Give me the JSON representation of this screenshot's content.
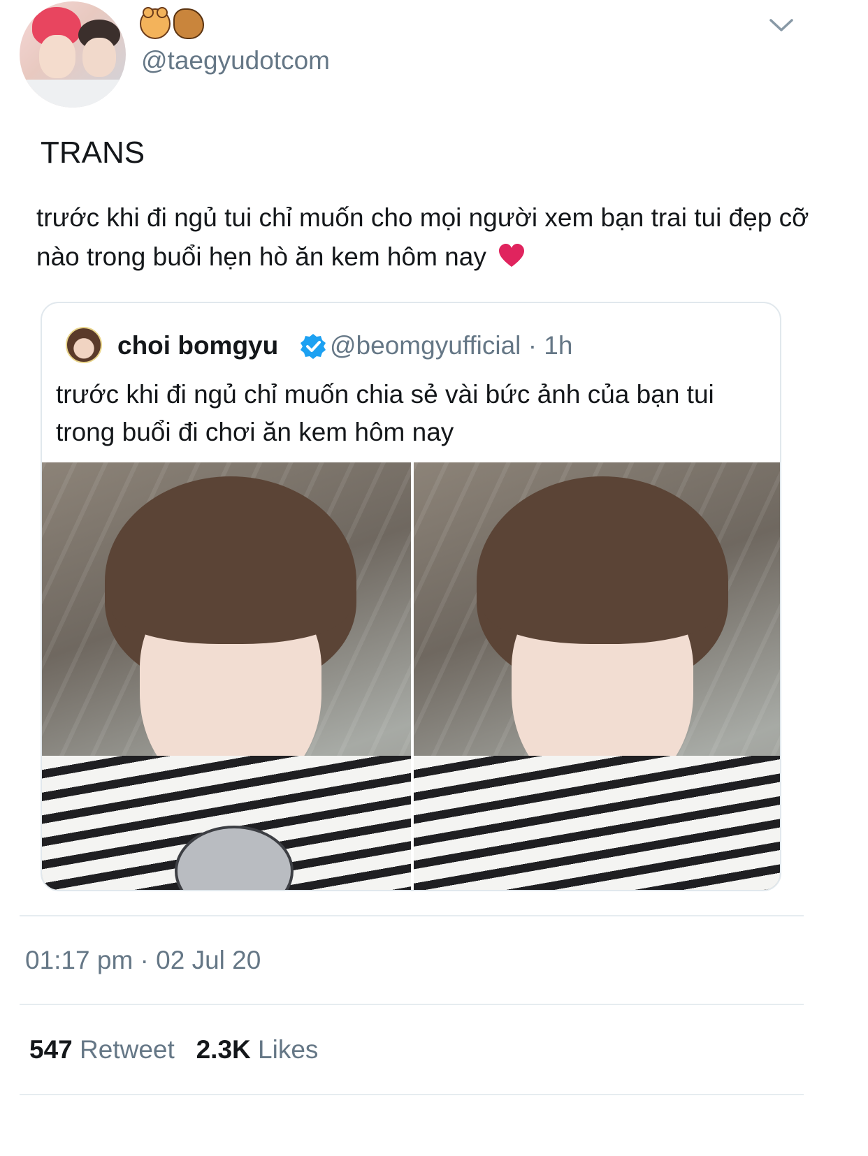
{
  "author": {
    "handle": "@taegyudotcom",
    "display_name_icons": [
      "bear-face-icon",
      "chipmunk-icon"
    ]
  },
  "tweet": {
    "title": "TRANS",
    "text": "trước khi đi ngủ tui chỉ muốn cho mọi người xem bạn trai tui đẹp cỡ nào trong buổi hẹn hò ăn kem hôm nay",
    "trailing_emoji": "red-heart-icon"
  },
  "quoted_tweet": {
    "name": "choi bomgyu",
    "verified": true,
    "handle": "@beomgyufficial",
    "separator": "·",
    "time_ago": "1h",
    "text": "trước khi đi ngủ chỉ muốn chia sẻ vài bức ảnh của bạn tui trong buổi đi chơi ăn kem hôm nay",
    "photo_count": 2
  },
  "meta": {
    "timestamp": "01:17 pm · 02 Jul 20",
    "retweets_count": "547",
    "retweets_label": "Retweet",
    "likes_count": "2.3K",
    "likes_label": "Likes"
  },
  "colors": {
    "text_primary": "#14171a",
    "text_secondary": "#657786",
    "verified_blue": "#1da1f2",
    "heart_red": "#e0245e",
    "divider": "#e6ecf0"
  }
}
